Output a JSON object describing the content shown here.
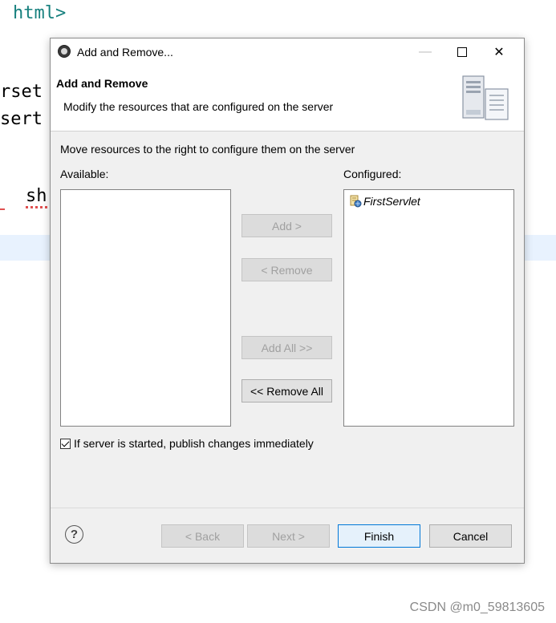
{
  "editor": {
    "lines": [
      "html>",
      "rset",
      "sert",
      "sh"
    ]
  },
  "watermark": "CSDN @m0_59813605",
  "dialog": {
    "title": "Add and Remove...",
    "header_title": "Add and Remove",
    "header_description": "Modify the resources that are configured on the server",
    "instruction": "Move resources to the right to configure them on the server",
    "available_label": "Available:",
    "configured_label": "Configured:",
    "available_items": [],
    "configured_items": [
      {
        "label": "FirstServlet",
        "icon": "web-module-icon"
      }
    ],
    "buttons": {
      "add": "Add >",
      "remove": "< Remove",
      "add_all": "Add All >>",
      "remove_all": "<< Remove All",
      "back": "< Back",
      "next": "Next >",
      "finish": "Finish",
      "cancel": "Cancel"
    },
    "publish_checkbox": {
      "label": "If server is started, publish changes immediately",
      "checked": true
    },
    "help_symbol": "?"
  },
  "colors": {
    "accent": "#0078d7",
    "tag": "#17807e",
    "dialog_bg": "#f0f0f0"
  }
}
